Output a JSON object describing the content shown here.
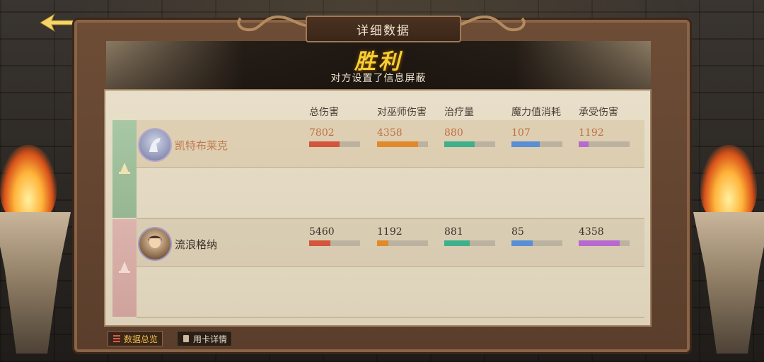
{
  "header": {
    "title": "详细数据"
  },
  "result": {
    "outcome": "胜利",
    "notice": "对方设置了信息屏蔽"
  },
  "columns": [
    "总伤害",
    "对巫师伤害",
    "治疗量",
    "魔力值消耗",
    "承受伤害"
  ],
  "colors": {
    "total_damage": "#d2553c",
    "wizard_damage": "#e08a2c",
    "healing": "#3fb08c",
    "mana": "#5a8fd6",
    "taken": "#b66ad0"
  },
  "players": [
    {
      "team": "ally",
      "name": "凯特布莱克",
      "avatar_icon": "white-horse-avatar-icon",
      "stats": {
        "total_damage": "7802",
        "wizard_damage": "4358",
        "healing": "880",
        "mana": "107",
        "taken": "1192"
      },
      "fill": {
        "total_damage": 0.6,
        "wizard_damage": 0.8,
        "healing": 0.6,
        "mana": 0.55,
        "taken": 0.2
      }
    },
    {
      "team": "enemy",
      "name": "流浪格纳",
      "avatar_icon": "wizard-portrait-avatar-icon",
      "stats": {
        "total_damage": "5460",
        "wizard_damage": "1192",
        "healing": "881",
        "mana": "85",
        "taken": "4358"
      },
      "fill": {
        "total_damage": 0.42,
        "wizard_damage": 0.22,
        "healing": 0.5,
        "mana": 0.42,
        "taken": 0.8
      }
    }
  ],
  "tabs": [
    {
      "label": "数据总览",
      "active": true,
      "icon": "list-icon"
    },
    {
      "label": "用卡详情",
      "active": false,
      "icon": "card-icon"
    }
  ]
}
